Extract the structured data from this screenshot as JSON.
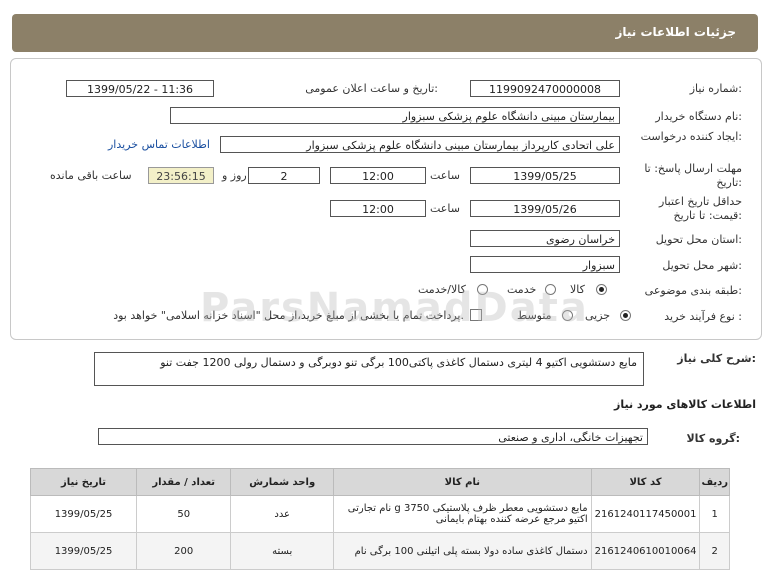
{
  "header": {
    "title": "جزئیات اطلاعات نیاز"
  },
  "fields": {
    "need_number_label": "شماره نیاز:",
    "need_number": "1199092470000008",
    "announce_label": "تاریخ و ساعت اعلان عمومی:",
    "announce_value": "1399/05/22 - 11:36",
    "buyer_label": "نام دستگاه خریدار:",
    "buyer_value": "بیمارستان مبینی دانشگاه علوم پزشکی سبزوار",
    "creator_label": "ایجاد کننده درخواست:",
    "creator_value": "علی اتحادی کارپرداز بیمارستان مبینی دانشگاه علوم پزشکی سبزوار",
    "contact_link": "اطلاعات تماس خریدار",
    "deadline_label": "مهلت ارسال پاسخ: تا تاریخ:",
    "deadline_date": "1399/05/25",
    "time_label": "ساعت",
    "deadline_time": "12:00",
    "days_value": "2",
    "days_label": "روز و",
    "remaining_time": "23:56:15",
    "remaining_label": "ساعت باقی مانده",
    "validity_label": "حداقل تاریخ اعتبار قیمت: تا تاریخ:",
    "validity_date": "1399/05/26",
    "validity_time": "12:00",
    "province_label": "استان محل تحویل:",
    "province_value": "خراسان رضوی",
    "city_label": "شهر محل تحویل:",
    "city_value": "سبزوار",
    "category_label": "طبقه بندی موضوعی:",
    "category_options": [
      "کالا",
      "خدمت",
      "کالا/خدمت"
    ],
    "process_label": "نوع فرآیند خرید :",
    "process_options": [
      "جزیی",
      "متوسط"
    ],
    "payment_note": "پرداخت تمام یا بخشی از مبلغ خرید،از محل \"اسناد خزانه اسلامی\" خواهد بود."
  },
  "description": {
    "label": "شرح کلی نیاز:",
    "text": "مایع دستشویی اکتیو  4 لیتری  دستمال کاغذی پاکتی100 برگی  تنو  دوبرگی و دستمال  رولی 1200 جفت تنو"
  },
  "goods_section": {
    "title": "اطلاعات کالاهای مورد نیاز",
    "group_label": "گروه کالا:",
    "group_value": "تجهیزات خانگی، اداری و صنعتی"
  },
  "watermark": "ParsNamadData",
  "table": {
    "headers": [
      "ردیف",
      "کد کالا",
      "نام کالا",
      "واحد شمارش",
      "تعداد / مقدار",
      "تاریخ نیاز"
    ],
    "rows": [
      [
        "1",
        "2161240117450001",
        "مایع دستشویی معطر ظرف پلاستیکی 3750 g نام تجارتی اکتیو مرجع عرضه کننده بهتام بایمانی",
        "عدد",
        "50",
        "1399/05/25"
      ],
      [
        "2",
        "2161240610010064",
        "دستمال کاغذی ساده دولا بسته پلی اتیلنی 100 برگی نام",
        "بسته",
        "200",
        "1399/05/25"
      ]
    ]
  }
}
